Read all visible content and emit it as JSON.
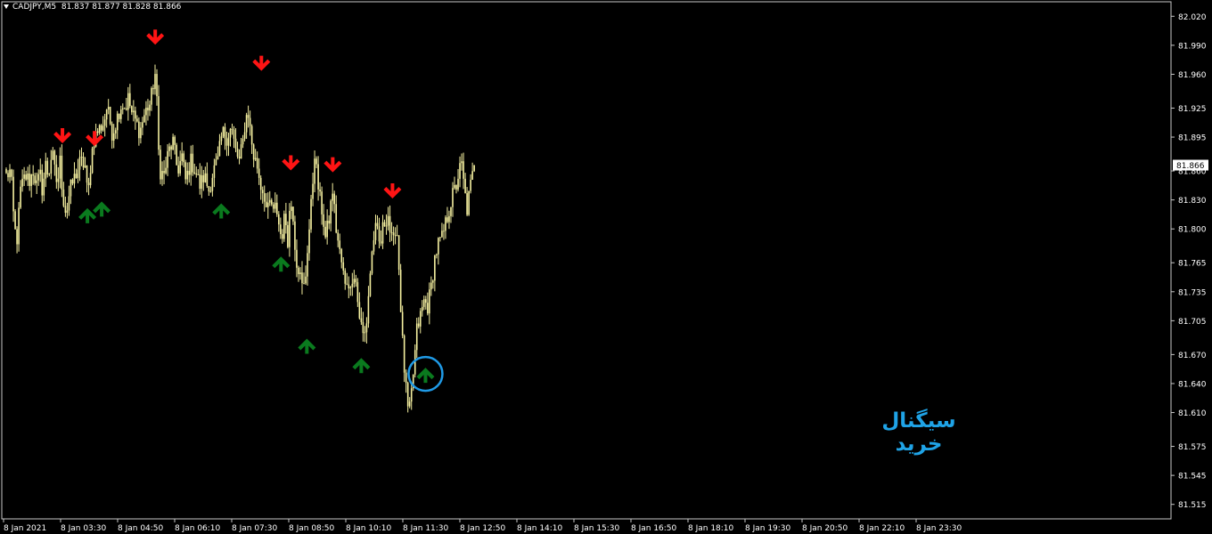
{
  "header": {
    "symbol": "CADJPY,M5",
    "ohlc": "81.837 81.877 81.828 81.866"
  },
  "annotation": {
    "signal_label": "سیگنال خرید"
  },
  "colors": {
    "background": "#000000",
    "candle": "#f5f0a0",
    "frame": "#c8c8c8",
    "sell_arrow": "#ff1414",
    "buy_arrow": "#0a7a1e",
    "circle": "#1f9ae6",
    "label": "#1fa3e6"
  },
  "chart_data": {
    "type": "candlestick",
    "symbol": "CADJPY",
    "timeframe": "M5",
    "ylim": [
      81.5,
      82.035
    ],
    "current_price": 81.866,
    "price_ticks": [
      "82.020",
      "81.990",
      "81.960",
      "81.925",
      "81.895",
      "81.860",
      "81.830",
      "81.800",
      "81.765",
      "81.735",
      "81.705",
      "81.670",
      "81.640",
      "81.610",
      "81.575",
      "81.545",
      "81.515"
    ],
    "time_ticks": [
      "8 Jan 2021",
      "8 Jan 03:30",
      "8 Jan 04:50",
      "8 Jan 06:10",
      "8 Jan 07:30",
      "8 Jan 08:50",
      "8 Jan 10:10",
      "8 Jan 11:30",
      "8 Jan 12:50",
      "8 Jan 14:10",
      "8 Jan 15:30",
      "8 Jan 16:50",
      "8 Jan 18:10",
      "8 Jan 19:30",
      "8 Jan 20:50",
      "8 Jan 22:10",
      "8 Jan 23:30"
    ],
    "bar_count": 255,
    "anchors": [
      [
        0,
        81.855
      ],
      [
        5,
        81.86
      ],
      [
        9,
        81.8
      ],
      [
        12,
        81.79
      ],
      [
        16,
        81.84
      ],
      [
        21,
        81.855
      ],
      [
        26,
        81.85
      ],
      [
        30,
        81.86
      ],
      [
        34,
        81.845
      ],
      [
        38,
        81.855
      ],
      [
        41,
        81.835
      ],
      [
        43,
        81.87
      ],
      [
        47,
        81.855
      ],
      [
        51,
        81.88
      ],
      [
        54,
        81.86
      ],
      [
        57,
        81.845
      ],
      [
        60,
        81.87
      ],
      [
        63,
        81.835
      ],
      [
        67,
        81.815
      ],
      [
        71,
        81.84
      ],
      [
        75,
        81.85
      ],
      [
        79,
        81.86
      ],
      [
        83,
        81.87
      ],
      [
        88,
        81.865
      ],
      [
        91,
        81.83
      ],
      [
        94,
        81.865
      ],
      [
        97,
        81.89
      ],
      [
        101,
        81.9
      ],
      [
        105,
        81.905
      ],
      [
        109,
        81.91
      ],
      [
        112,
        81.925
      ],
      [
        115,
        81.915
      ],
      [
        118,
        81.9
      ],
      [
        121,
        81.905
      ],
      [
        125,
        81.92
      ],
      [
        129,
        81.93
      ],
      [
        133,
        81.925
      ],
      [
        136,
        81.935
      ],
      [
        140,
        81.92
      ],
      [
        145,
        81.91
      ],
      [
        149,
        81.9
      ],
      [
        153,
        81.915
      ],
      [
        157,
        81.925
      ],
      [
        161,
        81.93
      ],
      [
        163,
        81.945
      ],
      [
        166,
        81.96
      ],
      [
        168,
        81.93
      ],
      [
        170,
        81.88
      ],
      [
        172,
        81.86
      ],
      [
        176,
        81.855
      ],
      [
        181,
        81.88
      ],
      [
        186,
        81.89
      ],
      [
        191,
        81.86
      ],
      [
        196,
        81.875
      ],
      [
        200,
        81.85
      ],
      [
        206,
        81.87
      ],
      [
        211,
        81.86
      ],
      [
        216,
        81.845
      ],
      [
        221,
        81.855
      ],
      [
        226,
        81.84
      ],
      [
        231,
        81.86
      ],
      [
        236,
        81.87
      ],
      [
        241,
        81.9
      ],
      [
        246,
        81.895
      ],
      [
        251,
        81.905
      ],
      [
        256,
        81.88
      ],
      [
        260,
        81.87
      ],
      [
        264,
        81.89
      ],
      [
        267,
        81.915
      ],
      [
        270,
        81.92
      ],
      [
        273,
        81.895
      ],
      [
        276,
        81.875
      ],
      [
        280,
        81.865
      ],
      [
        284,
        81.845
      ],
      [
        288,
        81.835
      ],
      [
        291,
        81.815
      ],
      [
        295,
        81.83
      ],
      [
        298,
        81.815
      ],
      [
        301,
        81.825
      ],
      [
        304,
        81.805
      ],
      [
        307,
        81.79
      ],
      [
        311,
        81.815
      ],
      [
        314,
        81.79
      ],
      [
        317,
        81.83
      ],
      [
        320,
        81.815
      ],
      [
        323,
        81.77
      ],
      [
        326,
        81.76
      ],
      [
        330,
        81.74
      ],
      [
        333,
        81.74
      ],
      [
        336,
        81.78
      ],
      [
        339,
        81.81
      ],
      [
        342,
        81.85
      ],
      [
        344,
        81.88
      ],
      [
        347,
        81.85
      ],
      [
        350,
        81.83
      ],
      [
        353,
        81.815
      ],
      [
        356,
        81.79
      ],
      [
        360,
        81.81
      ],
      [
        364,
        81.84
      ],
      [
        368,
        81.8
      ],
      [
        372,
        81.775
      ],
      [
        375,
        81.76
      ],
      [
        378,
        81.74
      ],
      [
        381,
        81.75
      ],
      [
        384,
        81.735
      ],
      [
        387,
        81.76
      ],
      [
        390,
        81.745
      ],
      [
        393,
        81.715
      ],
      [
        396,
        81.7
      ],
      [
        399,
        81.685
      ],
      [
        402,
        81.705
      ],
      [
        405,
        81.745
      ],
      [
        408,
        81.775
      ],
      [
        411,
        81.8
      ],
      [
        414,
        81.795
      ],
      [
        417,
        81.78
      ],
      [
        420,
        81.8
      ],
      [
        423,
        81.81
      ],
      [
        426,
        81.815
      ],
      [
        429,
        81.79
      ],
      [
        432,
        81.785
      ],
      [
        435,
        81.81
      ],
      [
        437,
        81.78
      ],
      [
        439,
        81.74
      ],
      [
        441,
        81.7
      ],
      [
        443,
        81.665
      ],
      [
        445,
        81.645
      ],
      [
        447,
        81.62
      ],
      [
        449,
        81.605
      ],
      [
        451,
        81.62
      ],
      [
        453,
        81.64
      ],
      [
        455,
        81.66
      ],
      [
        458,
        81.695
      ],
      [
        462,
        81.71
      ],
      [
        466,
        81.725
      ],
      [
        470,
        81.72
      ],
      [
        474,
        81.74
      ],
      [
        478,
        81.77
      ],
      [
        482,
        81.785
      ],
      [
        486,
        81.79
      ],
      [
        490,
        81.805
      ],
      [
        494,
        81.82
      ],
      [
        498,
        81.835
      ],
      [
        502,
        81.845
      ],
      [
        505,
        81.86
      ],
      [
        508,
        81.865
      ],
      [
        511,
        81.84
      ],
      [
        514,
        81.82
      ],
      [
        517,
        81.84
      ],
      [
        520,
        81.855
      ],
      [
        522,
        81.866
      ]
    ],
    "sell_arrows": [
      {
        "bar": 63,
        "price": 81.895
      },
      {
        "bar": 99,
        "price": 81.892
      },
      {
        "bar": 167,
        "price": 81.997
      },
      {
        "bar": 286,
        "price": 81.97
      },
      {
        "bar": 319,
        "price": 81.867
      },
      {
        "bar": 366,
        "price": 81.865
      },
      {
        "bar": 433,
        "price": 81.838
      }
    ],
    "buy_arrows": [
      {
        "bar": 91,
        "price": 81.815
      },
      {
        "bar": 107,
        "price": 81.822
      },
      {
        "bar": 241,
        "price": 81.82
      },
      {
        "bar": 308,
        "price": 81.765
      },
      {
        "bar": 337,
        "price": 81.68
      },
      {
        "bar": 398,
        "price": 81.66
      },
      {
        "bar": 470,
        "price": 81.65
      }
    ],
    "highlighted_signal": {
      "bar": 470,
      "price": 81.65,
      "label": "سیگنال خرید"
    }
  }
}
